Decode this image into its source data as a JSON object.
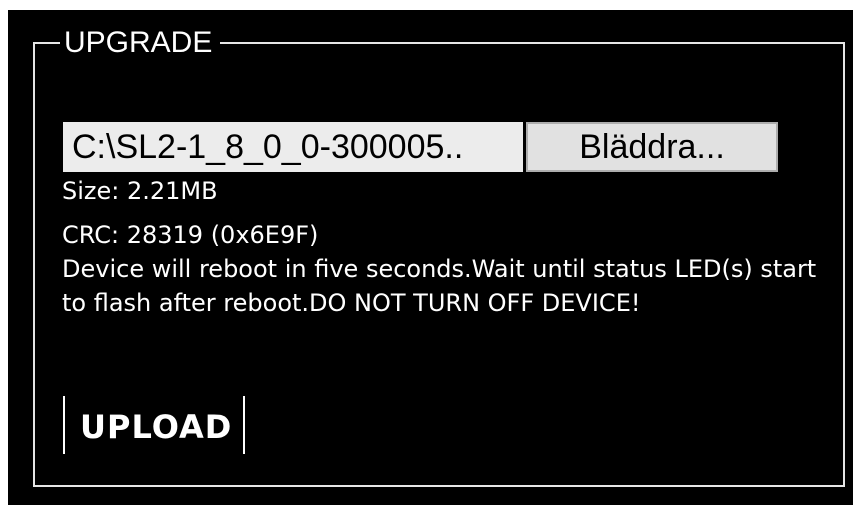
{
  "upgrade": {
    "legend": "UPGRADE",
    "file_input": {
      "value": "C:\\SL2-1_8_0_0-300005..",
      "browse_label": "Bläddra..."
    },
    "size": "Size: 2.21MB",
    "crc": "CRC: 28319 (0x6E9F)",
    "message": "Device will reboot in five seconds.Wait until status LED(s) start to flash after reboot.DO NOT TURN OFF DEVICE!",
    "upload_label": "UPLOAD"
  },
  "colors": {
    "background": "#000000",
    "text": "#ffffff",
    "border": "#e6e6e6",
    "input_background": "#ececec",
    "button_background": "#e1e1e1"
  }
}
